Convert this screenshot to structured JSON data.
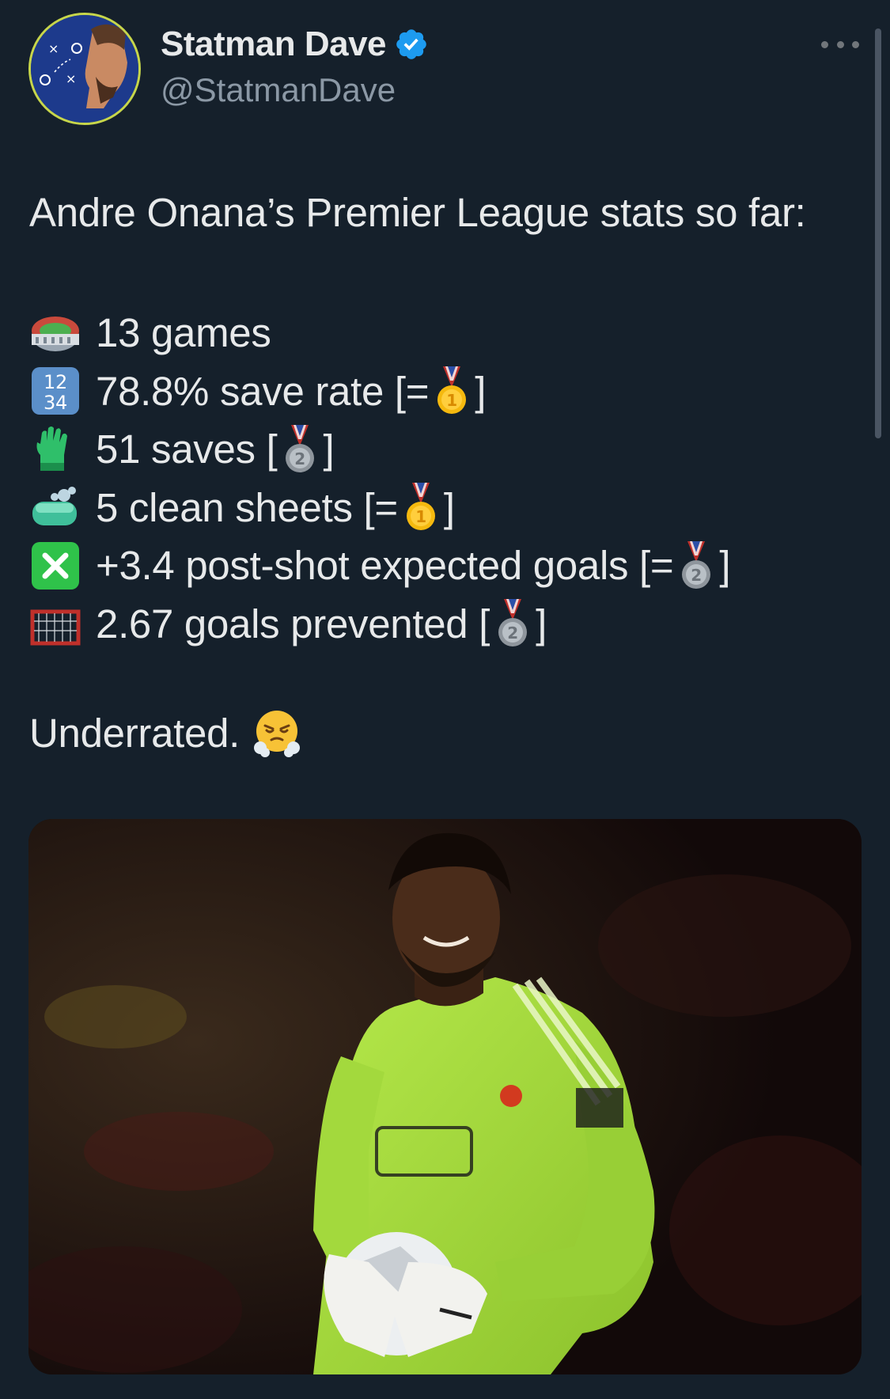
{
  "author": {
    "display_name": "Statman Dave",
    "handle": "@StatmanDave",
    "verified_icon": "verified-badge-icon",
    "avatar_icon": "tactics-board-avatar"
  },
  "tweet": {
    "intro": "Andre Onana’s Premier League stats so far:",
    "stats": [
      {
        "icon": "stadium-emoji",
        "text": "13 games",
        "prefix": "",
        "medal": "",
        "suffix": ""
      },
      {
        "icon": "input-numbers-emoji",
        "text": "78.8% save rate [=",
        "medal": "gold",
        "suffix": "]"
      },
      {
        "icon": "gloves-emoji",
        "text": "51 saves [",
        "medal": "silver",
        "suffix": "]"
      },
      {
        "icon": "soap-emoji",
        "text": "5 clean sheets [=",
        "medal": "gold",
        "suffix": "]"
      },
      {
        "icon": "cross-mark-button-emoji",
        "text": "+3.4 post-shot expected goals [=",
        "medal": "silver",
        "suffix": "]"
      },
      {
        "icon": "goal-net-emoji",
        "text": "2.67 goals prevented [",
        "medal": "silver",
        "suffix": "]"
      }
    ],
    "closing": "Underrated.",
    "closing_emoji": "face-with-steam-emoji",
    "medal_labels": {
      "gold": "1",
      "silver": "2"
    }
  },
  "media": {
    "image_icon": "goalkeeper-photo"
  },
  "colors": {
    "background": "#15202b",
    "text": "#e7e9ea",
    "muted": "#8b98a5",
    "verified": "#1d9bf0",
    "kit_green": "#a3d93d"
  }
}
